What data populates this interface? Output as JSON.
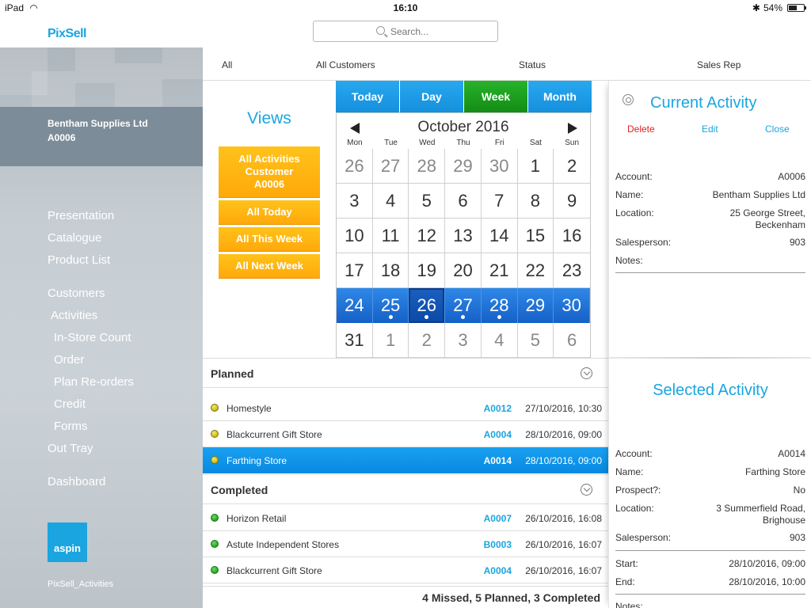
{
  "status_bar": {
    "device": "iPad",
    "time": "16:10",
    "battery": "54%",
    "battery_level": 0.54
  },
  "app": {
    "name": "PixSell",
    "search_placeholder": "Search...",
    "screen_name": "PixSell_Activities"
  },
  "sidebar": {
    "account_name": "Bentham Supplies Ltd",
    "account_code": "A0006",
    "menu": [
      "Presentation",
      "Catalogue",
      "Product List",
      "Customers",
      "Activities",
      "In-Store Count",
      "Order",
      "Plan Re-orders",
      "Credit",
      "Forms",
      "Out Tray",
      "Dashboard"
    ],
    "brand": "aspin"
  },
  "filters": {
    "all": "All",
    "customers": "All Customers",
    "status": "Status",
    "sales_rep": "Sales Rep"
  },
  "views": {
    "title": "Views",
    "buttons": [
      "All Activities Customer A0006",
      "All Today",
      "All This Week",
      "All Next Week"
    ]
  },
  "modes": {
    "today": "Today",
    "day": "Day",
    "week": "Week",
    "month": "Month",
    "active": "Week"
  },
  "calendar": {
    "month_label": "October 2016",
    "dows": [
      "Mon",
      "Tue",
      "Wed",
      "Thu",
      "Fri",
      "Sat",
      "Sun"
    ],
    "weeks": [
      [
        "26",
        "27",
        "28",
        "29",
        "30",
        "1",
        "2"
      ],
      [
        "3",
        "4",
        "5",
        "6",
        "7",
        "8",
        "9"
      ],
      [
        "10",
        "11",
        "12",
        "13",
        "14",
        "15",
        "16"
      ],
      [
        "17",
        "18",
        "19",
        "20",
        "21",
        "22",
        "23"
      ],
      [
        "24",
        "25",
        "26",
        "27",
        "28",
        "29",
        "30"
      ],
      [
        "31",
        "1",
        "2",
        "3",
        "4",
        "5",
        "6"
      ]
    ],
    "selected_week": 4,
    "selected_day": "26",
    "event_days": [
      "25",
      "26",
      "27",
      "28"
    ]
  },
  "planned": {
    "title": "Planned",
    "rows": [
      {
        "name": "Homestyle",
        "account": "A0012",
        "datetime": "27/10/2016, 10:30",
        "status": "yellow",
        "selected": false
      },
      {
        "name": "Blackcurrent Gift Store",
        "account": "A0004",
        "datetime": "28/10/2016, 09:00",
        "status": "yellow",
        "selected": false
      },
      {
        "name": "Farthing Store",
        "account": "A0014",
        "datetime": "28/10/2016, 09:00",
        "status": "yellow",
        "selected": true
      }
    ]
  },
  "completed": {
    "title": "Completed",
    "rows": [
      {
        "name": "Horizon Retail",
        "account": "A0007",
        "datetime": "26/10/2016, 16:08",
        "status": "green"
      },
      {
        "name": "Astute Independent Stores",
        "account": "B0003",
        "datetime": "26/10/2016, 16:07",
        "status": "green"
      },
      {
        "name": "Blackcurrent Gift Store",
        "account": "A0004",
        "datetime": "26/10/2016, 16:07",
        "status": "green"
      }
    ]
  },
  "summary": "4 Missed, 5 Planned, 3 Completed",
  "current_activity": {
    "title": "Current Activity",
    "actions": {
      "delete": "Delete",
      "edit": "Edit",
      "close": "Close"
    },
    "fields": {
      "account_label": "Account:",
      "account": "A0006",
      "name_label": "Name:",
      "name": "Bentham Supplies Ltd",
      "location_label": "Location:",
      "location_1": "25 George Street,",
      "location_2": "Beckenham",
      "salesperson_label": "Salesperson:",
      "salesperson": "903",
      "notes_label": "Notes:"
    }
  },
  "selected_activity": {
    "title": "Selected Activity",
    "fields": {
      "account_label": "Account:",
      "account": "A0014",
      "name_label": "Name:",
      "name": "Farthing Store",
      "prospect_label": "Prospect?:",
      "prospect": "No",
      "location_label": "Location:",
      "location_1": "3 Summerfield Road,",
      "location_2": "Brighouse",
      "salesperson_label": "Salesperson:",
      "salesperson": "903",
      "start_label": "Start:",
      "start": "28/10/2016, 09:00",
      "end_label": "End:",
      "end": "28/10/2016, 10:00",
      "notes_label": "Notes:"
    }
  },
  "colors": {
    "accent": "#1aa5e0",
    "orange": "#ffb011",
    "week_green": "#1f9f21",
    "delete_red": "#e02020"
  }
}
